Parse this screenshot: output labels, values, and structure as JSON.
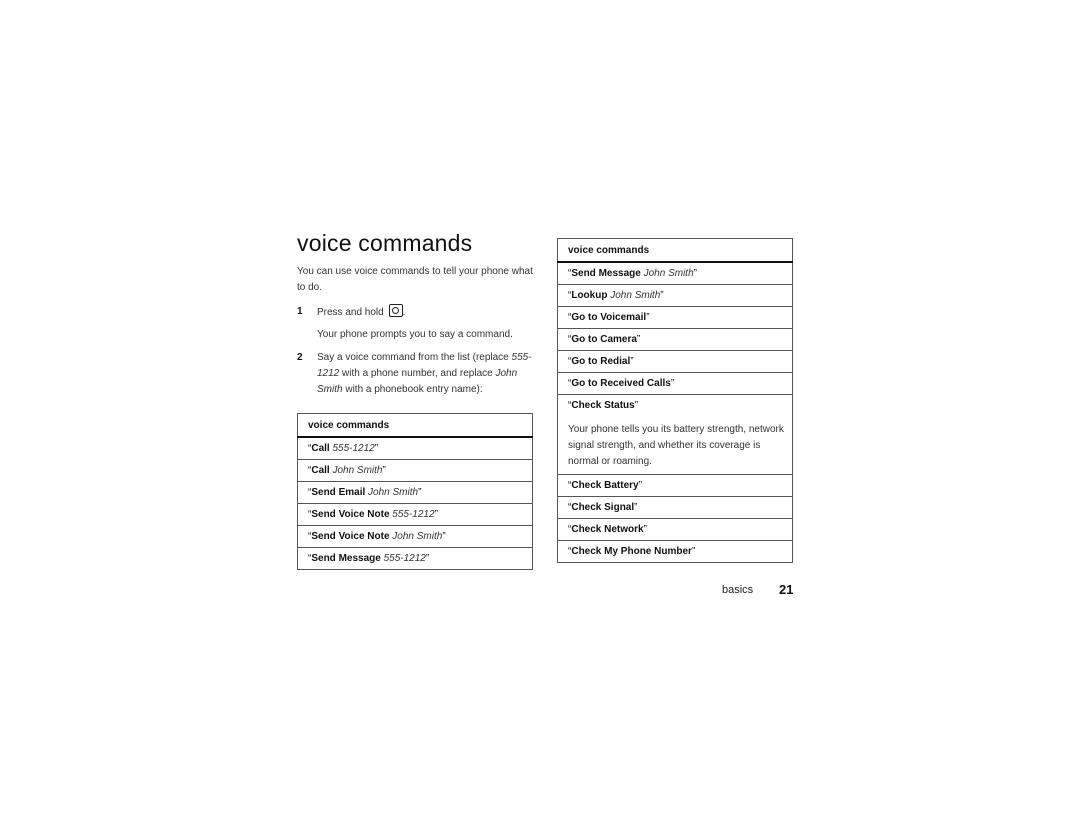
{
  "page": {
    "title": "voice commands",
    "intro": "You can use voice commands to tell your phone what to do.",
    "steps": [
      {
        "num": "1",
        "text_before": "Press and hold",
        "icon": "voice-key-icon",
        "text_after": ".",
        "sub": "Your phone prompts you to say a command."
      },
      {
        "num": "2",
        "text_a": "Say a voice command from the list (replace ",
        "text_b": "555-1212",
        "text_c": " with a phone number, and replace ",
        "text_d": "John Smith",
        "text_e": " with a phonebook entry name):"
      }
    ],
    "footer": {
      "section": "basics",
      "page_number": "21"
    }
  },
  "table_left": {
    "header": "voice commands",
    "rows": [
      {
        "cmd": "Call",
        "arg": "555-1212"
      },
      {
        "cmd": "Call",
        "arg": "John Smith"
      },
      {
        "cmd": "Send Email",
        "arg": "John Smith"
      },
      {
        "cmd": "Send Voice Note",
        "arg": "555-1212"
      },
      {
        "cmd": "Send Voice Note",
        "arg": "John Smith"
      },
      {
        "cmd": "Send Message",
        "arg": "555-1212"
      }
    ]
  },
  "table_right": {
    "header": "voice commands",
    "rows": [
      {
        "cmd": "Send Message",
        "arg": "John Smith"
      },
      {
        "cmd": "Lookup",
        "arg": "John Smith"
      },
      {
        "cmd": "Go to Voicemail",
        "arg": ""
      },
      {
        "cmd": "Go to Camera",
        "arg": ""
      },
      {
        "cmd": "Go to Redial",
        "arg": ""
      },
      {
        "cmd": "Go to Received Calls",
        "arg": ""
      },
      {
        "cmd": "Check Status",
        "arg": "",
        "description": "Your phone tells you its battery strength, network signal strength, and whether its coverage is normal or roaming."
      },
      {
        "cmd": "Check Battery",
        "arg": ""
      },
      {
        "cmd": "Check Signal",
        "arg": ""
      },
      {
        "cmd": "Check Network",
        "arg": ""
      },
      {
        "cmd": "Check My Phone Number",
        "arg": ""
      }
    ]
  },
  "quote_open": "“",
  "quote_close": "”"
}
